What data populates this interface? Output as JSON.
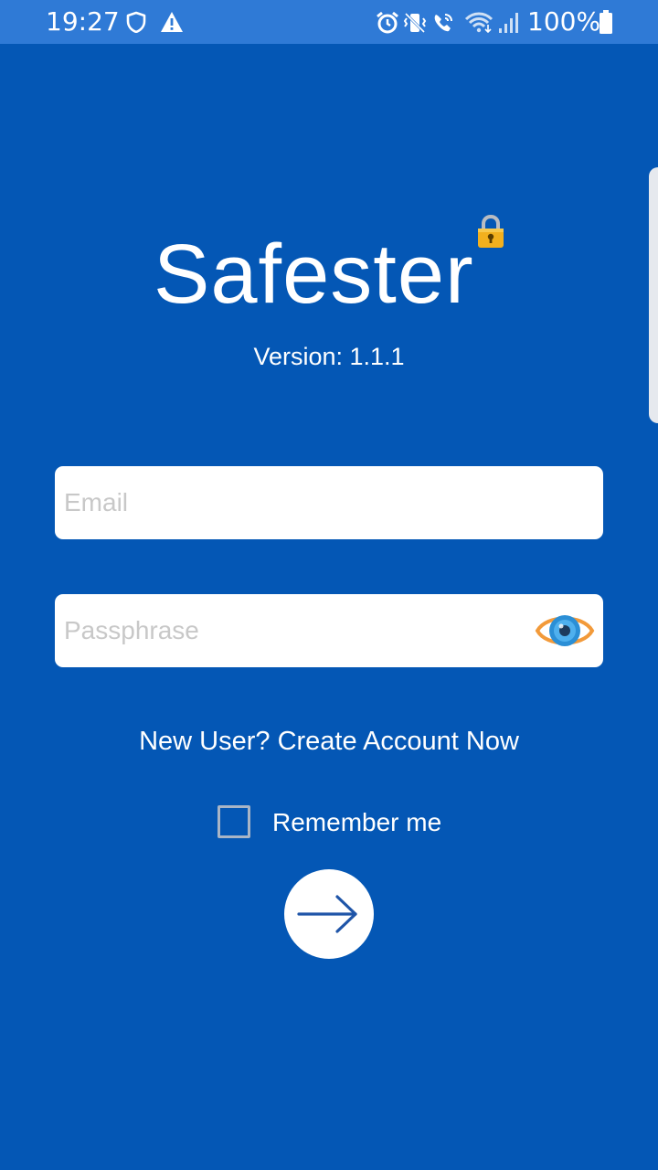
{
  "status_bar": {
    "time": "19:27",
    "battery": "100%",
    "icons": [
      "shield-icon",
      "warning-icon",
      "alarm-icon",
      "vibrate-icon",
      "wifi-calling-icon",
      "wifi-icon",
      "signal-icon",
      "battery-icon"
    ]
  },
  "app": {
    "name": "Safester",
    "version": "Version: 1.1.1",
    "logo_icon": "padlock-icon"
  },
  "form": {
    "email_placeholder": "Email",
    "email_value": "",
    "passphrase_placeholder": "Passphrase",
    "passphrase_value": "",
    "show_passphrase_icon": "eye-icon",
    "create_account_link": "New User? Create Account Now",
    "remember_me_label": "Remember me",
    "remember_me_checked": false,
    "submit_icon": "arrow-right-icon"
  },
  "colors": {
    "background": "#0457b5",
    "status_bar": "#2f7ad6",
    "field_background": "#ffffff",
    "text": "#ffffff",
    "placeholder": "#c8c8c8",
    "lock_gold": "#f2b01e",
    "eye_blue": "#2b8fd6",
    "eye_orange": "#f29a3a"
  }
}
